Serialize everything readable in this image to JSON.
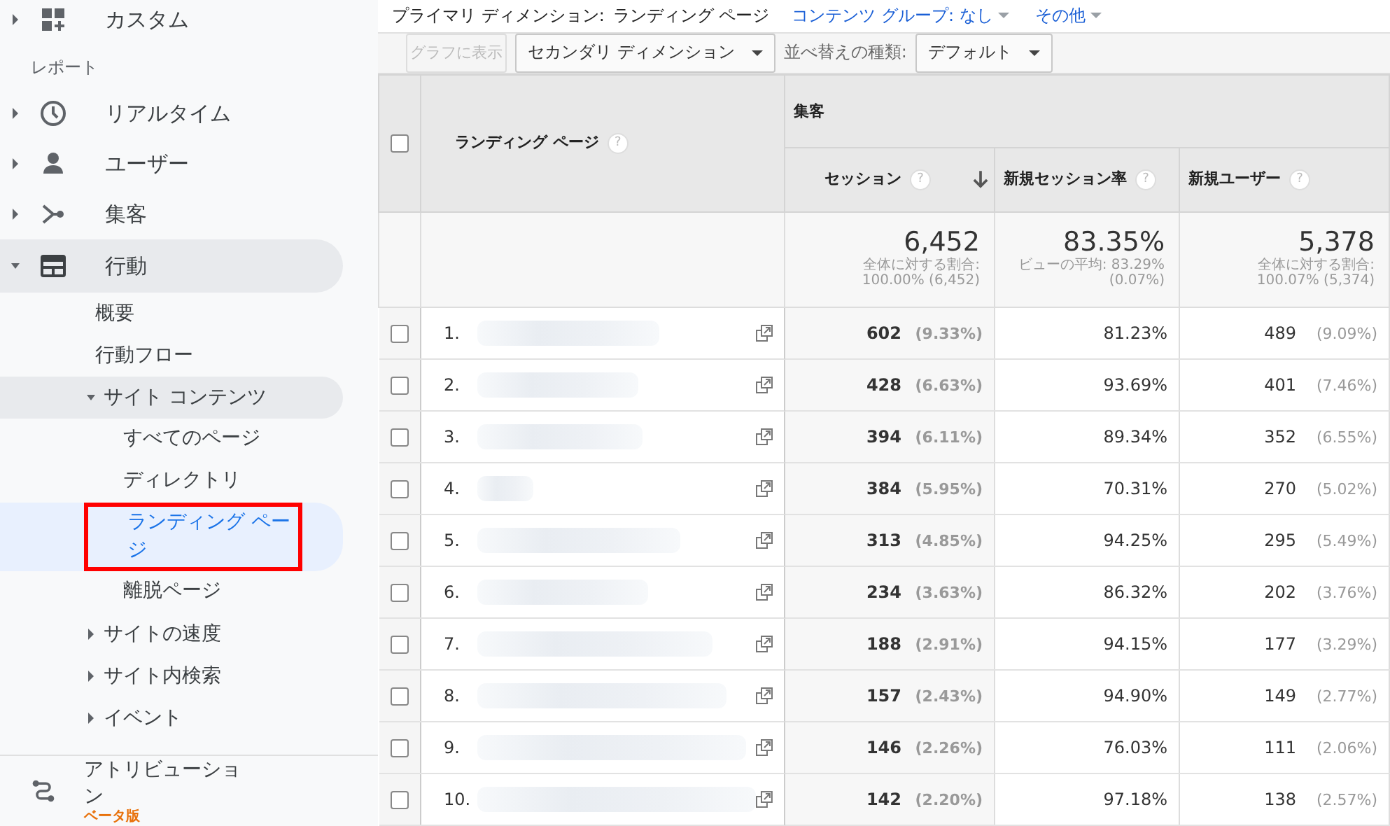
{
  "sidebar": {
    "top_items": [
      {
        "label": "カスタム",
        "expanded": false
      }
    ],
    "section_label": "レポート",
    "items": [
      {
        "label": "リアルタイム",
        "expanded": false
      },
      {
        "label": "ユーザー",
        "expanded": false
      },
      {
        "label": "集客",
        "expanded": false
      },
      {
        "label": "行動",
        "expanded": true,
        "children": [
          {
            "label": "概要",
            "kind": "link",
            "selected": false
          },
          {
            "label": "行動フロー",
            "kind": "link",
            "selected": false
          },
          {
            "label": "サイト コンテンツ",
            "kind": "group",
            "expanded": true,
            "selected": false,
            "children": [
              {
                "label": "すべてのページ",
                "selected": false,
                "boxed": false
              },
              {
                "label": "ディレクトリ",
                "selected": false,
                "boxed": false
              },
              {
                "label": "ランディング ページ",
                "selected": true,
                "boxed": true
              },
              {
                "label": "離脱ページ",
                "selected": false,
                "boxed": false
              }
            ]
          },
          {
            "label": "サイトの速度",
            "kind": "group",
            "expanded": false,
            "selected": false
          },
          {
            "label": "サイト内検索",
            "kind": "group",
            "expanded": false,
            "selected": false
          },
          {
            "label": "イベント",
            "kind": "group",
            "expanded": false,
            "selected": false
          }
        ]
      }
    ],
    "attribution": {
      "label": "アトリビューション",
      "badge": "ベータ版"
    }
  },
  "dimension_bar": {
    "label": "プライマリ ディメンション:",
    "value": "ランディング ページ",
    "links": [
      "コンテンツ グループ: なし",
      "その他"
    ]
  },
  "toolbar": {
    "chart_button": {
      "label": "グラフに表示",
      "disabled": true
    },
    "secondary_dropdown": "セカンダリ ディメンション",
    "sort_label": "並べ替えの種類:",
    "sort_dropdown": "デフォルト"
  },
  "table": {
    "select_all_checked": false,
    "dimension_header": {
      "label": "ランディング ページ",
      "help": "?"
    },
    "group_header": "集客",
    "columns": [
      {
        "label": "セッション",
        "help": "?",
        "sorted": true
      },
      {
        "label": "新規セッション率",
        "help": "?",
        "sorted": false
      },
      {
        "label": "新規ユーザー",
        "help": "?",
        "sorted": false
      }
    ],
    "totals": [
      {
        "value": "6,452",
        "note": "全体に対する割合:",
        "detail": "100.00% (6,452)"
      },
      {
        "value": "83.35%",
        "note": "ビューの平均: 83.29%",
        "detail": "(0.07%)"
      },
      {
        "value": "5,378",
        "note": "全体に対する割合:",
        "detail": "100.07% (5,374)"
      }
    ],
    "rows": [
      {
        "rank": "1.",
        "checked": false,
        "sessions": "602",
        "sessions_pct": "(9.33%)",
        "rate": "81.23%",
        "users": "489",
        "users_pct": "(9.09%)"
      },
      {
        "rank": "2.",
        "checked": false,
        "sessions": "428",
        "sessions_pct": "(6.63%)",
        "rate": "93.69%",
        "users": "401",
        "users_pct": "(7.46%)"
      },
      {
        "rank": "3.",
        "checked": false,
        "sessions": "394",
        "sessions_pct": "(6.11%)",
        "rate": "89.34%",
        "users": "352",
        "users_pct": "(6.55%)"
      },
      {
        "rank": "4.",
        "checked": false,
        "sessions": "384",
        "sessions_pct": "(5.95%)",
        "rate": "70.31%",
        "users": "270",
        "users_pct": "(5.02%)"
      },
      {
        "rank": "5.",
        "checked": false,
        "sessions": "313",
        "sessions_pct": "(4.85%)",
        "rate": "94.25%",
        "users": "295",
        "users_pct": "(5.49%)"
      },
      {
        "rank": "6.",
        "checked": false,
        "sessions": "234",
        "sessions_pct": "(3.63%)",
        "rate": "86.32%",
        "users": "202",
        "users_pct": "(3.76%)"
      },
      {
        "rank": "7.",
        "checked": false,
        "sessions": "188",
        "sessions_pct": "(2.91%)",
        "rate": "94.15%",
        "users": "177",
        "users_pct": "(3.29%)"
      },
      {
        "rank": "8.",
        "checked": false,
        "sessions": "157",
        "sessions_pct": "(2.43%)",
        "rate": "94.90%",
        "users": "149",
        "users_pct": "(2.77%)"
      },
      {
        "rank": "9.",
        "checked": false,
        "sessions": "146",
        "sessions_pct": "(2.26%)",
        "rate": "76.03%",
        "users": "111",
        "users_pct": "(2.06%)"
      },
      {
        "rank": "10.",
        "checked": false,
        "sessions": "142",
        "sessions_pct": "(2.20%)",
        "rate": "97.18%",
        "users": "138",
        "users_pct": "(2.57%)"
      }
    ]
  }
}
